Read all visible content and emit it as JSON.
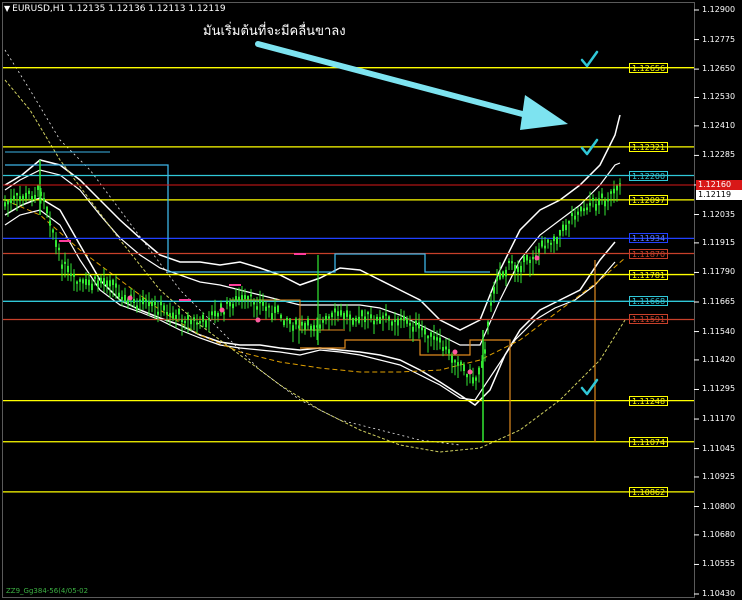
{
  "window": {
    "symbol_line": "EURUSD,H1  1.12135 1.12136 1.12113 1.12119",
    "indicator_label": "ZZ9_Gg384-56(4/05-02"
  },
  "annotation": {
    "text": "มันเริ่มต้นที่จะมีคลื่นขาลง",
    "arrow_color": "#7de3f0"
  },
  "axis": {
    "ticks": [
      "1.12900",
      "1.12775",
      "1.12650",
      "1.12530",
      "1.12410",
      "1.12285",
      "1.12160",
      "1.12035",
      "1.11915",
      "1.11790",
      "1.11665",
      "1.11540",
      "1.11420",
      "1.11295",
      "1.11170",
      "1.11045",
      "1.10925",
      "1.10800",
      "1.10680",
      "1.10555",
      "1.10430"
    ]
  },
  "levels": [
    {
      "label": "1.12656",
      "color": "#ffff00",
      "style": "solid"
    },
    {
      "label": "1.12321",
      "color": "#ffff00",
      "style": "solid"
    },
    {
      "label": "1.12200",
      "color": "#30c8d8",
      "style": "solid"
    },
    {
      "label": "1.12097",
      "color": "#ffff00",
      "style": "solid"
    },
    {
      "label": "1.11934",
      "color": "#2040ff",
      "style": "solid"
    },
    {
      "label": "1.11870",
      "color": "#c8402a",
      "style": "solid"
    },
    {
      "label": "1.11781",
      "color": "#ffff00",
      "style": "solid"
    },
    {
      "label": "1.11668",
      "color": "#30c8d8",
      "style": "solid"
    },
    {
      "label": "1.11591",
      "color": "#c8402a",
      "style": "solid"
    },
    {
      "label": "1.11248",
      "color": "#ffff00",
      "style": "solid"
    },
    {
      "label": "1.11074",
      "color": "#ffff00",
      "style": "solid"
    },
    {
      "label": "1.10862",
      "color": "#ffff00",
      "style": "solid"
    }
  ],
  "price_tags": [
    {
      "label": "1.12160",
      "bg": "#d81818",
      "fg": "#ffffff"
    },
    {
      "label": "1.12119",
      "bg": "#ffffff",
      "fg": "#000000"
    }
  ],
  "checkmark_color": "#30c8d8",
  "colors": {
    "candles": "#33e833",
    "bands": "#ffffff",
    "ma_fast": "#e0a000",
    "ma_slow": "#d0d060",
    "blue_line": "#3cb4e6",
    "orange": "#e08a1e"
  }
}
